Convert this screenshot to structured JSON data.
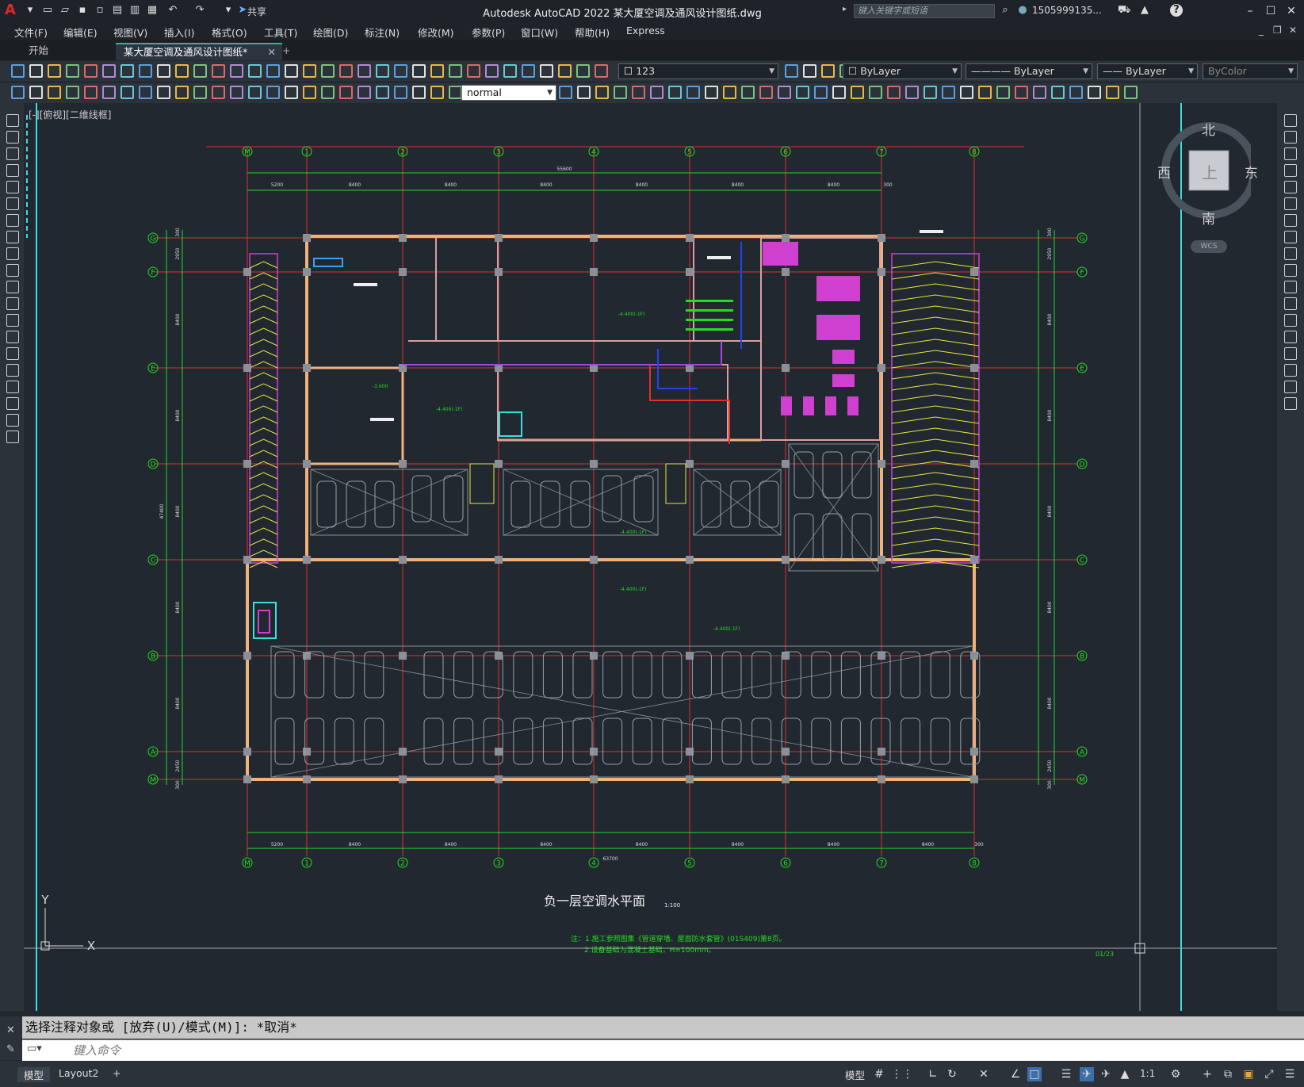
{
  "titlebar": {
    "app_icon": "A",
    "share": "共享",
    "title": "Autodesk AutoCAD 2022    某大厦空调及通风设计图纸.dwg",
    "search_placeholder": "键入关键字或短语",
    "user": "1505999135...",
    "help": "?"
  },
  "menubar": [
    "文件(F)",
    "编辑(E)",
    "视图(V)",
    "插入(I)",
    "格式(O)",
    "工具(T)",
    "绘图(D)",
    "标注(N)",
    "修改(M)",
    "参数(P)",
    "窗口(W)",
    "帮助(H)",
    "Express"
  ],
  "tabs": {
    "start": "开始",
    "doc": "某大厦空调及通风设计图纸*",
    "add": "+"
  },
  "toolbar": {
    "layer_value": "123",
    "color_value": "ByLayer",
    "linetype_value": "ByLayer",
    "lineweight_value": "ByLayer",
    "plotstyle_value": "ByColor",
    "textstyle_value": "normal"
  },
  "viewport_label": "[-][俯视][二维线框]",
  "compass": {
    "north": "北",
    "south": "南",
    "east": "东",
    "west": "西",
    "top": "上",
    "wcs": "WCS"
  },
  "drawing": {
    "title": "负一层空调水平面",
    "scale": "1:100",
    "notes": [
      "注：1.施工参照图集《管道穿墙、屋面防水套管》(01S409)第8页。",
      "2.设备基础为混凝土基础，H=100mm。"
    ],
    "sheet": "01/23",
    "col_axes": [
      "M",
      "1",
      "2",
      "3",
      "4",
      "5",
      "6",
      "7",
      "8"
    ],
    "row_axes": [
      "G",
      "F",
      "E",
      "D",
      "C",
      "B",
      "A",
      "M"
    ],
    "top_dims": [
      "5200",
      "8400",
      "8400",
      "8400",
      "8400",
      "8400",
      "8400",
      "300"
    ],
    "top_total": "55600",
    "bottom_dims": [
      "5200",
      "8400",
      "8400",
      "8400",
      "8400",
      "8400",
      "8400",
      "8400",
      "300"
    ],
    "bottom_total": "63700",
    "left_dims": [
      "300",
      "2950",
      "8400",
      "8400",
      "8400",
      "8400",
      "8400",
      "2450",
      "300"
    ],
    "left_total": "47400",
    "elev_labels": [
      "-4.400(-1F)",
      "-4.400(-1F)",
      "-3.600",
      "-4.400(-1F)",
      "-4.400(-1F)",
      "-4.400(-1F)"
    ],
    "ucs_x": "X",
    "ucs_y": "Y"
  },
  "command": {
    "history": "选择注释对象或 [放弃(U)/模式(M)]: *取消*",
    "placeholder": "键入命令"
  },
  "status": {
    "model_tab": "模型",
    "layout_tab": "Layout2",
    "add": "+",
    "model_btn": "模型",
    "scale": "1:1"
  }
}
